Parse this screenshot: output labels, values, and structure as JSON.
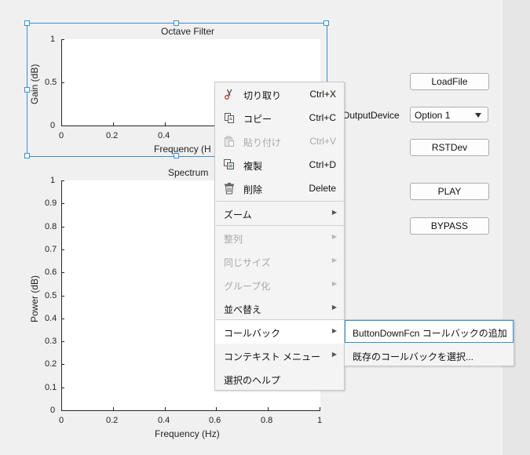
{
  "octave_axes": {
    "title": "Octave Filter",
    "xlabel": "Frequency (H",
    "ylabel": "Gain (dB)",
    "yticks": [
      "0",
      "0.5",
      "1"
    ],
    "xticks": [
      "0",
      "0.2",
      "0.4"
    ]
  },
  "spectrum_axes": {
    "title": "Spectrum",
    "xlabel": "Frequency (Hz)",
    "ylabel": "Power (dB)",
    "yticks": [
      "0",
      "0.1",
      "0.2",
      "0.3",
      "0.4",
      "0.5",
      "0.6",
      "0.7",
      "0.8",
      "0.9",
      "1"
    ],
    "xticks": [
      "0",
      "0.2",
      "0.4",
      "0.6",
      "0.8",
      "1"
    ]
  },
  "controls": {
    "load_file": "LoadFile",
    "output_device_label": "OutputDevice",
    "output_device_value": "Option 1",
    "rst_dev": "RSTDev",
    "play": "PLAY",
    "bypass": "BYPASS"
  },
  "context_menu": {
    "cut": {
      "label": "切り取り",
      "shortcut": "Ctrl+X"
    },
    "copy": {
      "label": "コピー",
      "shortcut": "Ctrl+C"
    },
    "paste": {
      "label": "貼り付け",
      "shortcut": "Ctrl+V"
    },
    "duplicate": {
      "label": "複製",
      "shortcut": "Ctrl+D"
    },
    "delete": {
      "label": "削除",
      "shortcut": "Delete"
    },
    "zoom": "ズーム",
    "align": "整列",
    "same_size": "同じサイズ",
    "group": "グループ化",
    "reorder": "並べ替え",
    "callback": "コールバック",
    "context_menu": "コンテキスト メニュー",
    "help": "選択のヘルプ"
  },
  "submenu": {
    "add_callback": "ButtonDownFcn コールバックの追加",
    "select_existing": "既存のコールバックを選択..."
  },
  "colors": {
    "selection": "#3a8fd2",
    "menu_bg": "#f4f4f4",
    "canvas_bg": "#f0f0f0"
  }
}
